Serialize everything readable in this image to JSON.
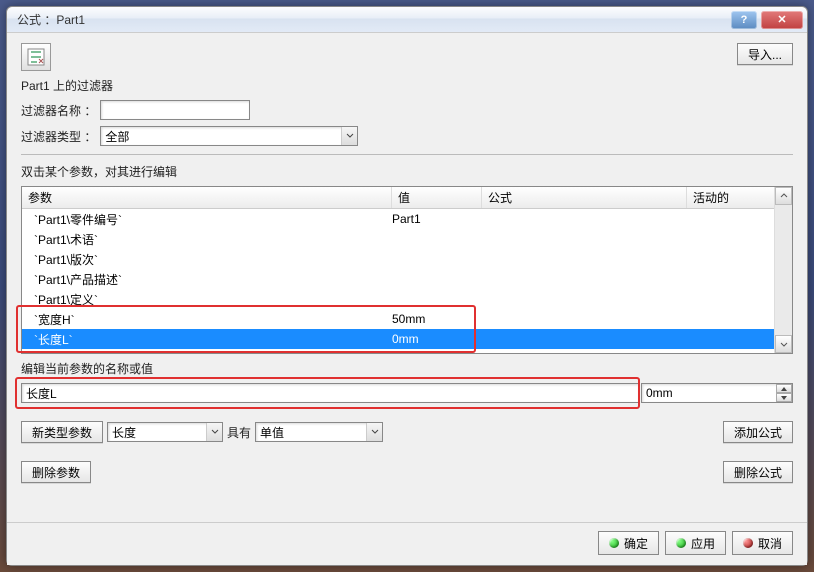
{
  "title": "公式 ：Part1",
  "import_btn": "导入...",
  "filter": {
    "section_label": "Part1 上的过滤器",
    "name_label": "过滤器名称 ：",
    "name_value": "",
    "type_label": "过滤器类型 ：",
    "type_value": "全部"
  },
  "table": {
    "caption": "双击某个参数，对其进行编辑",
    "headers": {
      "param": "参数",
      "value": "值",
      "formula": "公式",
      "active": "活动的"
    },
    "rows": [
      {
        "param": "`Part1\\零件编号`",
        "value": "Part1"
      },
      {
        "param": "`Part1\\术语`",
        "value": ""
      },
      {
        "param": "`Part1\\版次`",
        "value": ""
      },
      {
        "param": "`Part1\\产品描述`",
        "value": ""
      },
      {
        "param": "`Part1\\定义`",
        "value": ""
      },
      {
        "param": "`宽度H`",
        "value": "50mm"
      },
      {
        "param": "`长度L`",
        "value": "0mm",
        "selected": true
      }
    ]
  },
  "edit": {
    "caption": "编辑当前参数的名称或值",
    "name": "长度L",
    "value": "0mm"
  },
  "newparam": {
    "btn": "新类型参数",
    "type": "长度",
    "has_label": "具有",
    "qty": "单值"
  },
  "addformula_btn": "添加公式",
  "delparam_btn": "删除参数",
  "delformula_btn": "删除公式",
  "footer": {
    "ok": "确定",
    "apply": "应用",
    "cancel": "取消"
  }
}
